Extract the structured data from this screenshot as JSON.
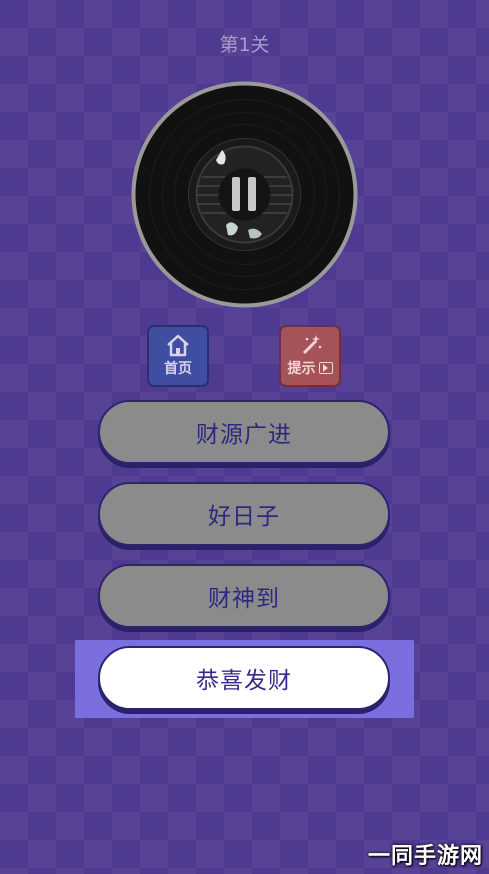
{
  "level": {
    "title": "第1关"
  },
  "player": {
    "state": "paused"
  },
  "buttons": {
    "home_label": "首页",
    "hint_label": "提示"
  },
  "options": [
    {
      "text": "财源广进",
      "selected": false
    },
    {
      "text": "好日子",
      "selected": false
    },
    {
      "text": "财神到",
      "selected": false
    },
    {
      "text": "恭喜发财",
      "selected": true
    }
  ],
  "watermark": {
    "text": "一同手游网"
  },
  "colors": {
    "background": "#4f3a91",
    "option_default": "#8b8b8b",
    "option_selected": "#ffffff",
    "option_text": "#2d2880",
    "home_button": "#3f4ea0",
    "hint_button": "#a55358"
  }
}
